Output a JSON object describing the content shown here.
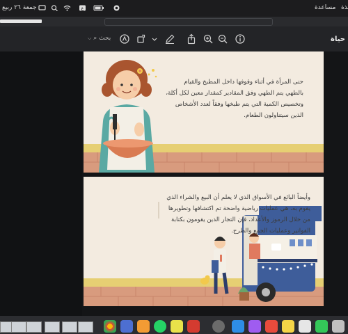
{
  "menubar": {
    "clock": "جمعة ٢٦ ربيع",
    "help": "مساعدة",
    "right_cut": "فذة"
  },
  "toolbar": {
    "search_label": "بحث",
    "window_title": "حياة"
  },
  "page1": {
    "text": "حتى المرأة في أثناء وقوفها داخل المطبخ والقيام بالطهي يتم الطهي وفق المقادير كمقدار معين لكل أكلة، وتخصيص الكمية التي يتم طبخها وفقاً لعدد الأشخاص الذين سيتناولون الطعام."
  },
  "page2": {
    "text": "وأيضاً البائع في الأسواق الذي لا يعلم أن البيع والشراء الذي يقوم به، هي عمليات رياضية واضحة تم اكتشافها وتطويرها من خلال الرموز والأعداد، فإن التجار الذين يقومون بكتابة الفواتير وعمليات الجمع والطرح."
  },
  "colors": {
    "page_bg": "#f3ebe0",
    "brick": "#d89b7e",
    "ledge": "#e6cf73",
    "truck_blue": "#3e5d9a"
  }
}
